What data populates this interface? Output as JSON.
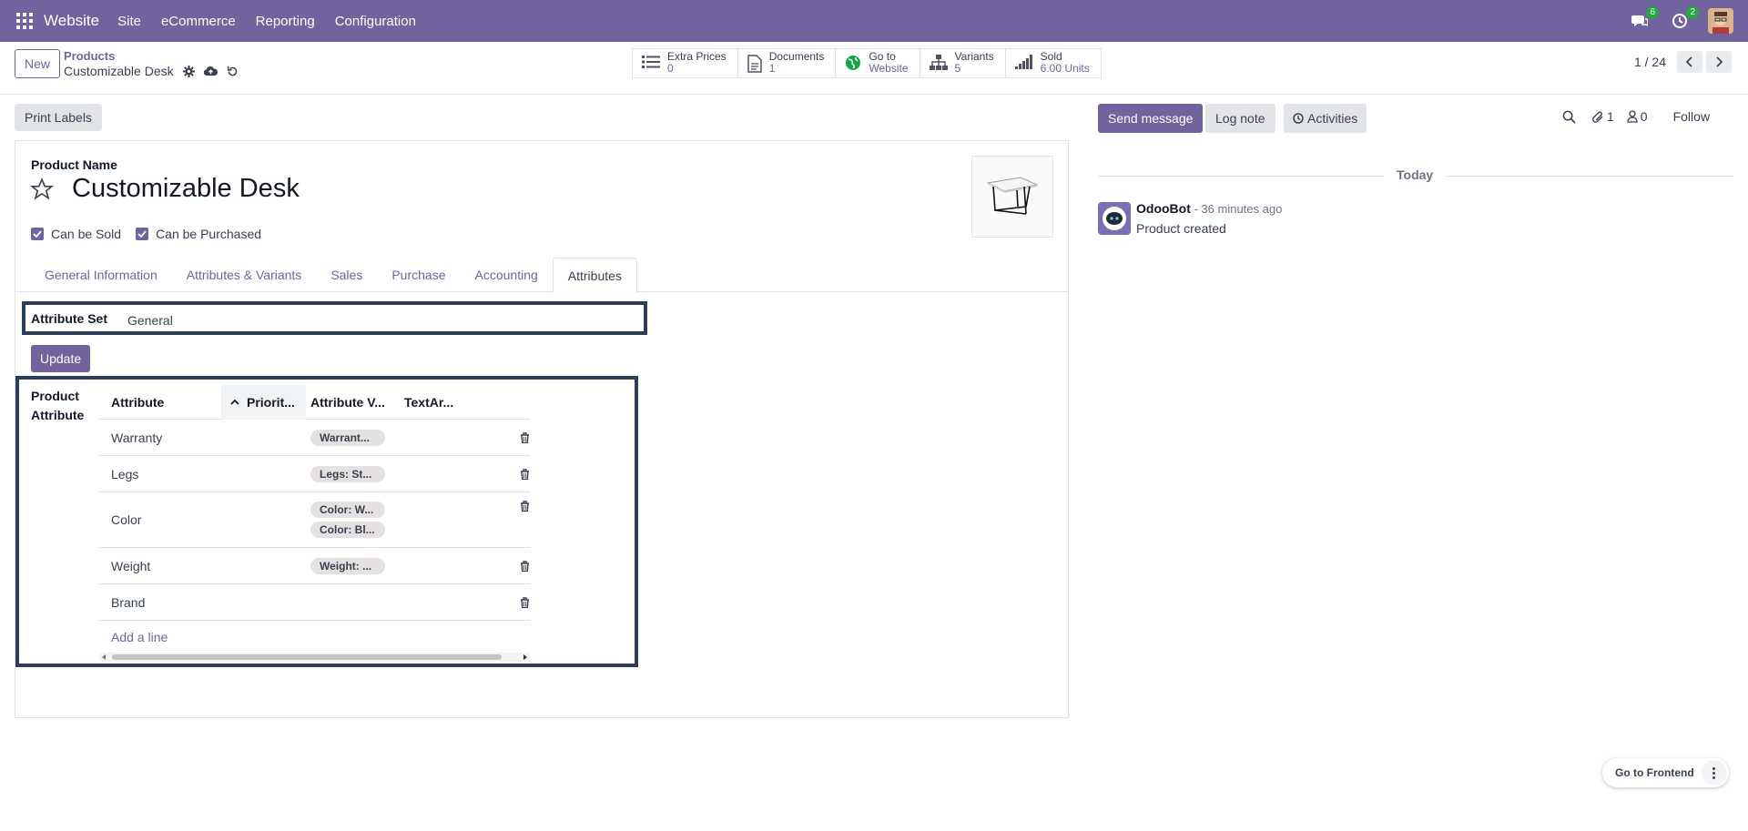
{
  "topbar": {
    "app_name": "Website",
    "menus": [
      "Site",
      "eCommerce",
      "Reporting",
      "Configuration"
    ],
    "messages_count": "6",
    "activities_count": "2",
    "color": "#71639e"
  },
  "control": {
    "new_label": "New",
    "breadcrumb_parent": "Products",
    "breadcrumb_current": "Customizable Desk",
    "smart_buttons": [
      {
        "label": "Extra Prices",
        "value": "0",
        "icon": "list-icon"
      },
      {
        "label": "Documents",
        "value": "1",
        "icon": "document-icon"
      },
      {
        "label": "Go to",
        "value": "Website",
        "icon": "globe-icon"
      },
      {
        "label": "Variants",
        "value": "5",
        "icon": "sitemap-icon"
      },
      {
        "label": "Sold",
        "value": "6.00 Units",
        "icon": "signal-icon"
      }
    ],
    "pager": "1 / 24"
  },
  "form": {
    "print_labels": "Print Labels",
    "product_name_label": "Product Name",
    "product_name": "Customizable Desk",
    "can_be_sold": "Can be Sold",
    "can_be_purchased": "Can be Purchased",
    "tabs": [
      "General Information",
      "Attributes & Variants",
      "Sales",
      "Purchase",
      "Accounting",
      "Attributes"
    ],
    "active_tab": "Attributes",
    "attribute_set_label": "Attribute Set",
    "attribute_set_value": "General",
    "update_label": "Update",
    "product_attribute_label": "Product Attribute",
    "table": {
      "headers": [
        "Attribute",
        "Priorit...",
        "Attribute V...",
        "TextAr..."
      ],
      "rows": [
        {
          "attribute": "Warranty",
          "values": [
            "Warrant..."
          ]
        },
        {
          "attribute": "Legs",
          "values": [
            "Legs: St..."
          ]
        },
        {
          "attribute": "Color",
          "values": [
            "Color: W...",
            "Color: Bl..."
          ]
        },
        {
          "attribute": "Weight",
          "values": [
            "Weight: ..."
          ]
        },
        {
          "attribute": "Brand",
          "values": []
        }
      ],
      "add_line": "Add a line"
    }
  },
  "chatter": {
    "send_message": "Send message",
    "log_note": "Log note",
    "activities": "Activities",
    "attachments_count": "1",
    "followers_count": "0",
    "follow": "Follow",
    "today": "Today",
    "message": {
      "author": "OdooBot",
      "time": " - 36 minutes ago",
      "body": "Product created"
    }
  },
  "frontend_button": "Go to Frontend"
}
